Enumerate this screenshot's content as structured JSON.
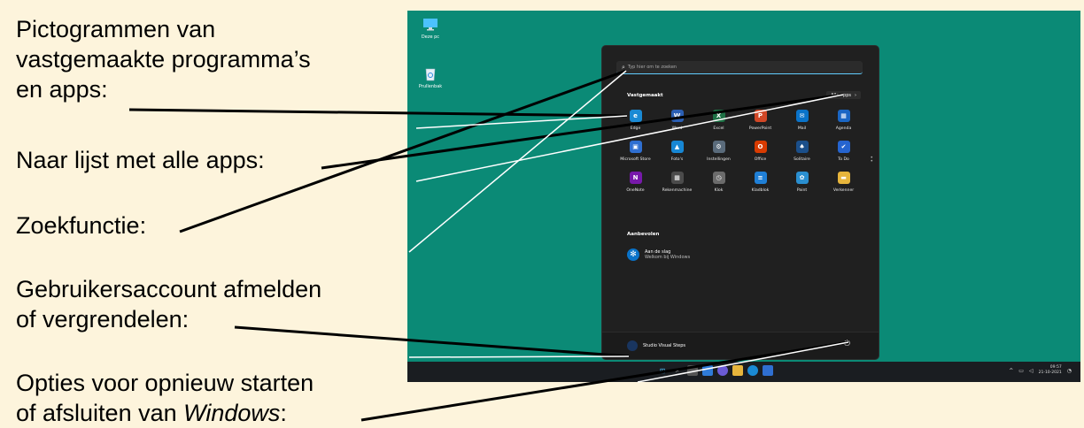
{
  "captions": {
    "pinned": [
      "Pictogrammen van",
      "vastgemaakte programma’s",
      "en apps:"
    ],
    "all_apps": "Naar lijst met alle apps:",
    "search": "Zoekfunctie:",
    "account": [
      "Gebruikersaccount afmelden",
      "of vergrendelen:"
    ],
    "power_prefix": "Opties voor opnieuw starten",
    "power_line2_prefix": "of afsluiten van ",
    "power_windows": "Windows",
    "power_suffix": ":"
  },
  "desktop": {
    "icons": [
      {
        "label": "Deze pc",
        "icon": "monitor-icon"
      },
      {
        "label": "Prullenbak",
        "icon": "recycle-bin-icon"
      }
    ],
    "background": "#0b8a76"
  },
  "start_menu": {
    "search_placeholder": "Typ hier om te zoeken",
    "pinned_title": "Vastgemaakt",
    "all_apps_label": "Alle apps",
    "apps": [
      {
        "label": "Edge",
        "glyph": "e",
        "color": "#1a8ad4"
      },
      {
        "label": "Word",
        "glyph": "W",
        "color": "#2b5fb4"
      },
      {
        "label": "Excel",
        "glyph": "X",
        "color": "#1e7145"
      },
      {
        "label": "PowerPoint",
        "glyph": "P",
        "color": "#d24726"
      },
      {
        "label": "Mail",
        "glyph": "✉",
        "color": "#0a73c9"
      },
      {
        "label": "Agenda",
        "glyph": "▦",
        "color": "#1a66c4"
      },
      {
        "label": "Microsoft Store",
        "glyph": "▣",
        "color": "#2f6fd1"
      },
      {
        "label": "Foto's",
        "glyph": "▲",
        "color": "#1787d4"
      },
      {
        "label": "Instellingen",
        "glyph": "⚙",
        "color": "#5a6b7b"
      },
      {
        "label": "Office",
        "glyph": "O",
        "color": "#d83b01"
      },
      {
        "label": "Solitaire",
        "glyph": "♠",
        "color": "#1b4f8a"
      },
      {
        "label": "To Do",
        "glyph": "✔",
        "color": "#2564cf"
      },
      {
        "label": "OneNote",
        "glyph": "N",
        "color": "#7719aa"
      },
      {
        "label": "Rekenmachine",
        "glyph": "▦",
        "color": "#4b4b4b"
      },
      {
        "label": "Klok",
        "glyph": "◷",
        "color": "#6b6b6b"
      },
      {
        "label": "Kladblok",
        "glyph": "≡",
        "color": "#1f7fd6"
      },
      {
        "label": "Paint",
        "glyph": "✿",
        "color": "#2a8fd0"
      },
      {
        "label": "Verkenner",
        "glyph": "▬",
        "color": "#e7b53c"
      }
    ],
    "recommended_title": "Aanbevolen",
    "recommended": {
      "title": "Aan de slag",
      "subtitle": "Welkom bij Windows",
      "icon": "get-started-icon"
    },
    "user_name": "Studio Visual Steps"
  },
  "taskbar": {
    "time": "09:57",
    "date": "21-10-2021",
    "icons": [
      "start-icon",
      "search-icon",
      "task-view-icon",
      "widgets-icon",
      "chat-icon",
      "file-explorer-icon",
      "edge-icon",
      "store-icon"
    ]
  }
}
